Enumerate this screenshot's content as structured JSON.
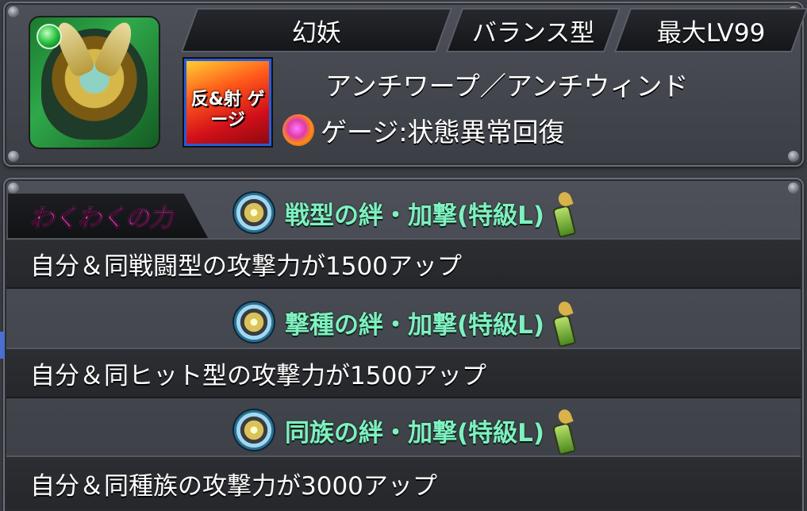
{
  "header": {
    "race": "幻妖",
    "type": "バランス型",
    "level": "最大LV99"
  },
  "monster": {
    "icon": "monster-portrait",
    "attribute_color": "#2fa84a"
  },
  "abilities": {
    "badge_text": "反&射 ゲージ",
    "main": "アンチワープ／アンチウィンド",
    "gauge": "ゲージ:状態異常回復"
  },
  "wakuwaku": {
    "title": "わくわくの力",
    "items": [
      {
        "name": "戦型の絆・加撃(特級L)",
        "description": "自分＆同戦闘型の攻撃力が1500アップ"
      },
      {
        "name": "撃種の絆・加撃(特級L)",
        "description": "自分＆同ヒット型の攻撃力が1500アップ"
      },
      {
        "name": "同族の絆・加撃(特級L)",
        "description": "自分＆同種族の攻撃力が3000アップ"
      }
    ]
  },
  "colors": {
    "skill_name": "#7ff0c0",
    "title_pink": "#ff7ad9",
    "panel": "#4d5058"
  }
}
